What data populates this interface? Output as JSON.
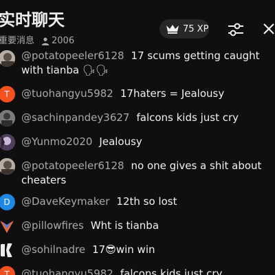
{
  "header": {
    "title": "实时聊天",
    "subtitle": "重要消息",
    "viewer_count": "2006",
    "xp_label": "75 XP"
  },
  "icons": {
    "viewers": "person-icon",
    "xp": "crown-icon",
    "tune": "tune-sliders-icon",
    "close": "close-icon"
  },
  "colors": {
    "background": "#0f0f0f",
    "author": "#aaaaaa",
    "text": "#f1f1f1",
    "pill": "#272727",
    "avatar_orange": "#f4511e",
    "avatar_blue": "#1e88e5",
    "emoji_blue": "#3b64d8"
  },
  "messages": [
    {
      "author": "@potatopeeler6128",
      "text": "17 scums getting caught with tianba 🗣🗣",
      "avatar": "photo"
    },
    {
      "author": "@tuohangyu5982",
      "text": "17haters = Jealousy",
      "avatar": "T"
    },
    {
      "author": "@sachinpandey3627",
      "text": "falcons kids just cry",
      "avatar": "photo"
    },
    {
      "author": "@Yunmo2020",
      "text": "Jealousy",
      "avatar": "photo"
    },
    {
      "author": "@potatopeeler6128",
      "text": "no one gives a shit about cheaters",
      "avatar": "photo"
    },
    {
      "author": "@DaveKeymaker",
      "text": "12th so lost",
      "avatar": "D"
    },
    {
      "author": "@pillowfires",
      "text": "Wht is tianba",
      "avatar": "photo"
    },
    {
      "author": "@sohilnadre",
      "text": "17😎win win",
      "avatar": "photo"
    },
    {
      "author": "@tuohangyu5982",
      "text": "falcons kids just cry",
      "avatar": "T"
    }
  ]
}
